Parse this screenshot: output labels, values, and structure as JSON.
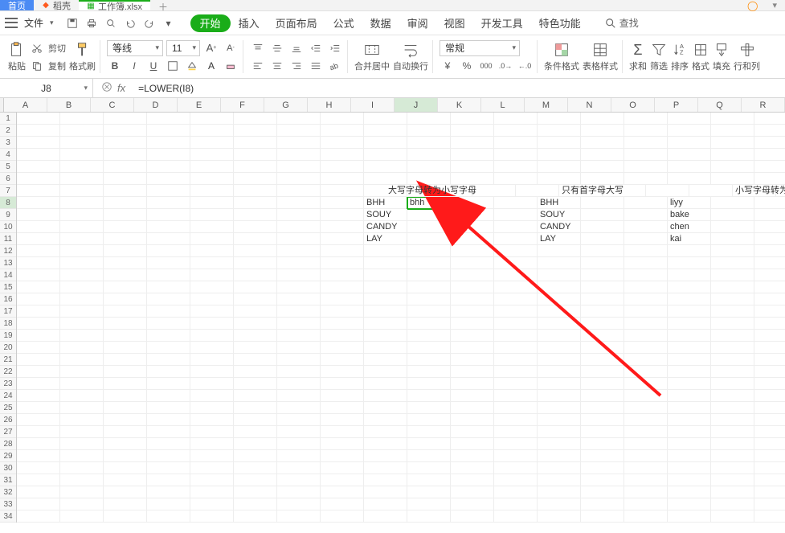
{
  "tabs": {
    "home": "首页",
    "daoke": "稻壳",
    "workbook": "工作簿.xlsx"
  },
  "ribbon": {
    "file": "文件",
    "tabs": [
      "开始",
      "插入",
      "页面布局",
      "公式",
      "数据",
      "审阅",
      "视图",
      "开发工具",
      "特色功能"
    ],
    "search": "查找"
  },
  "toolbar": {
    "paste": "粘贴",
    "cut": "剪切",
    "copy": "复制",
    "format_painter": "格式刷",
    "font_name": "等线",
    "font_size": "11",
    "bold": "B",
    "italic": "I",
    "underline": "U",
    "merge_center": "合并居中",
    "wrap_text": "自动换行",
    "number_format": "常规",
    "cond_fmt": "条件格式",
    "table_style": "表格样式",
    "autosum": "求和",
    "filter": "筛选",
    "sort": "排序",
    "format": "格式",
    "fill": "填充",
    "rowcol": "行和列"
  },
  "namebox": "J8",
  "formula": "=LOWER(I8)",
  "columns": [
    "A",
    "B",
    "C",
    "D",
    "E",
    "F",
    "G",
    "H",
    "I",
    "J",
    "K",
    "L",
    "M",
    "N",
    "O",
    "P",
    "Q",
    "R"
  ],
  "sheet": {
    "r7": {
      "J": "大写字母转为小写字母",
      "M": "只有首字母大写",
      "Q": "小写字母转为大写字母"
    },
    "r8": {
      "I": "BHH",
      "J": "bhh",
      "M": "BHH",
      "P": "liyy"
    },
    "r9": {
      "I": "SOUY",
      "M": "SOUY",
      "P": "bake"
    },
    "r10": {
      "I": "CANDY",
      "M": "CANDY",
      "P": "chen"
    },
    "r11": {
      "I": "LAY",
      "M": "LAY",
      "P": "kai"
    }
  },
  "chart_data": null
}
